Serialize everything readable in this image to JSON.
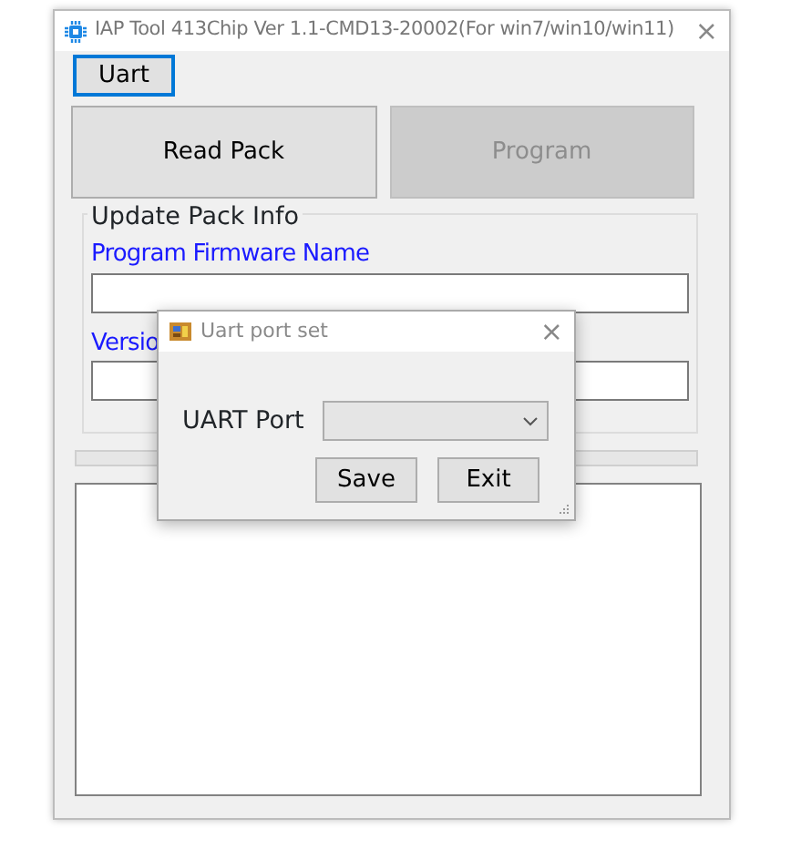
{
  "window": {
    "title": "IAP Tool 413Chip Ver 1.1-CMD13-20002(For win7/win10/win11)",
    "close": "×"
  },
  "uart_button": {
    "label": "Uart",
    "selected": true
  },
  "buttons": [
    {
      "label": "Read Pack",
      "disabled": false
    },
    {
      "label": "Program",
      "disabled": true
    }
  ],
  "update_pack_info": {
    "title": "Update Pack Info",
    "fields": [
      {
        "label": "Program Firmware Name"
      },
      {
        "label": "Versio"
      }
    ]
  },
  "dialog": {
    "title": "Uart port set",
    "close": "×",
    "port_label": "UART Port",
    "buttons": [
      "Save",
      "Exit"
    ]
  }
}
